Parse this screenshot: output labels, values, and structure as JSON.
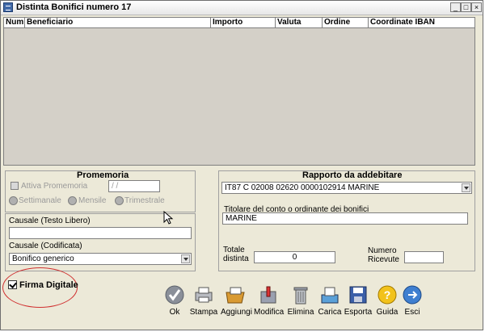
{
  "window": {
    "title": "Distinta Bonifici numero 17"
  },
  "grid": {
    "columns": [
      "Num",
      "Beneficiario",
      "Importo",
      "Valuta",
      "Ordine",
      "Coordinate IBAN"
    ]
  },
  "promemoria": {
    "title": "Promemoria",
    "attiva_label": "Attiva Promemoria",
    "date_value": " / /",
    "radio_settimanale": "Settimanale",
    "radio_mensile": "Mensile",
    "radio_trimestrale": "Trimestrale"
  },
  "causale": {
    "libero_label": "Causale (Testo Libero)",
    "libero_value": "",
    "codificata_label": "Causale (Codificata)",
    "codificata_value": "Bonifico generico"
  },
  "rapporto": {
    "title": "Rapporto da addebitare",
    "account_value": "IT87  C 02008 02620 0000102914      MARINE",
    "titolare_label": "Titolare del conto o ordinante dei bonifici",
    "titolare_value": "MARINE",
    "totale_label_1": "Totale",
    "totale_label_2": "distinta",
    "totale_value": "0",
    "numero_label_1": "Numero",
    "numero_label_2": "Ricevute",
    "numero_value": ""
  },
  "firma_digitale": {
    "label": "Firma Digitale",
    "checked": true
  },
  "toolbar": {
    "ok": "Ok",
    "stampa": "Stampa",
    "aggiungi": "Aggiungi",
    "modifica": "Modifica",
    "elimina": "Elimina",
    "carica": "Carica",
    "esporta": "Esporta",
    "guida": "Guida",
    "esci": "Esci"
  },
  "window_controls": {
    "minimize": "_",
    "maximize": "□",
    "close": "×"
  }
}
